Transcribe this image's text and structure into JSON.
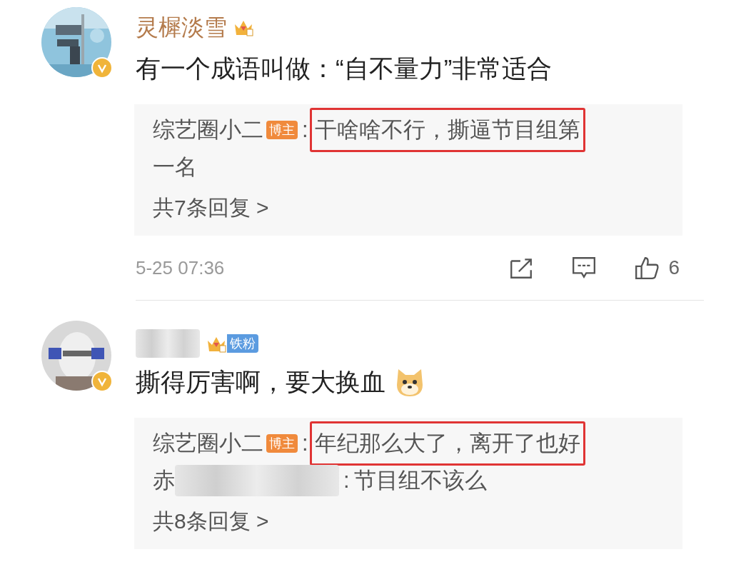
{
  "comments": [
    {
      "name": "灵樨淡雪",
      "verified": true,
      "text": "有一个成语叫做：“自不量力”非常适合",
      "replies": [
        {
          "author": "综艺圈小二",
          "badge": "博主",
          "colon": ":",
          "text": "干啥啥不行，撕逼节目组第",
          "highlighted": true
        },
        {
          "text": "一名",
          "highlighted": false
        }
      ],
      "more": "共7条回复 >",
      "time": "5-25 07:36",
      "likes": "6"
    },
    {
      "name_blurred": true,
      "fan_badge": "铁粉",
      "verified": true,
      "text": "撕得厉害啊，要大换血",
      "emoji": true,
      "replies": [
        {
          "author": "综艺圈小二",
          "badge": "博主",
          "colon": ":",
          "text": "年纪那么大了，离开了也好",
          "highlighted": true
        },
        {
          "author": "赤",
          "author_blurred": true,
          "colon": ":",
          "text": "节目组不该么",
          "highlighted": false
        }
      ],
      "more": "共8条回复 >"
    }
  ]
}
